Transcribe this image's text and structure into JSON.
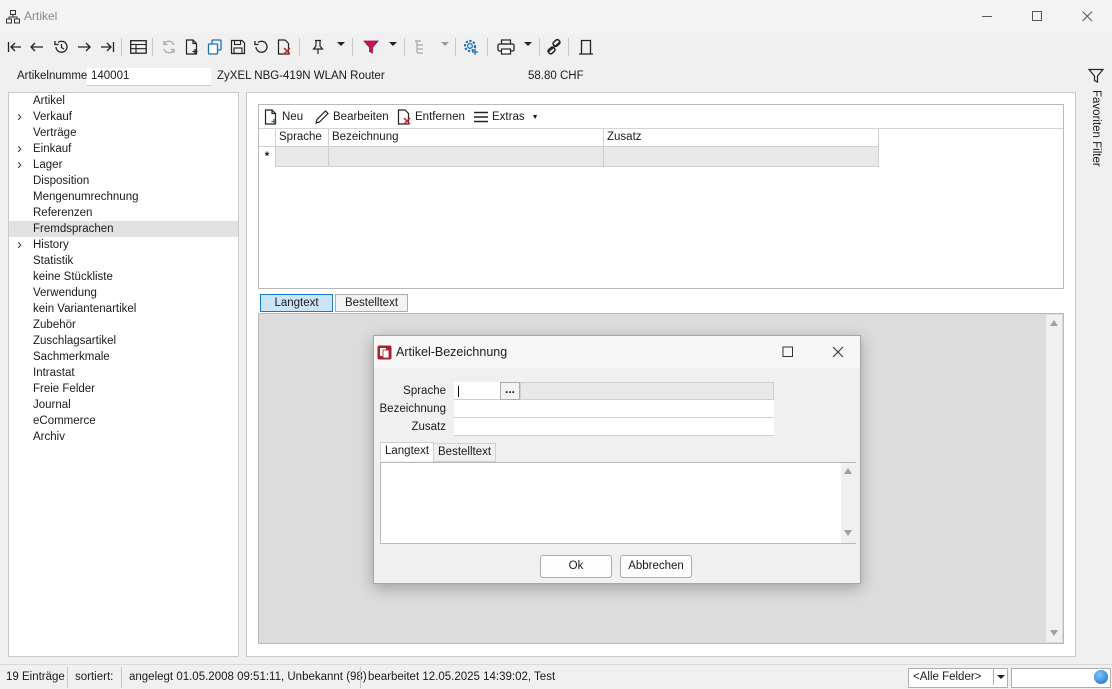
{
  "window": {
    "title": "Artikel",
    "accent_color": "#0078d4"
  },
  "toolbar": {
    "icons": [
      "first-record-icon",
      "previous-record-icon",
      "history-icon",
      "next-record-icon",
      "last-record-icon",
      "table-view-icon",
      "refresh-icon",
      "new-document-icon",
      "copy-icon",
      "save-icon",
      "undo-icon",
      "delete-icon",
      "pin-icon",
      "filter-icon",
      "tree-sort-icon",
      "settings-icon",
      "print-icon",
      "link-icon",
      "door-exit-icon"
    ]
  },
  "header": {
    "artnr_label": "Artikelnummer",
    "artnr_value": "140001",
    "name": "ZyXEL NBG-419N WLAN Router",
    "price": "58.80  CHF"
  },
  "side_filter": {
    "label": "Favoriten Filter"
  },
  "tree": {
    "items": [
      {
        "label": "Artikel",
        "expandable": false,
        "selected": false
      },
      {
        "label": "Verkauf",
        "expandable": true,
        "selected": false
      },
      {
        "label": "Verträge",
        "expandable": false,
        "selected": false
      },
      {
        "label": "Einkauf",
        "expandable": true,
        "selected": false
      },
      {
        "label": "Lager",
        "expandable": true,
        "selected": false
      },
      {
        "label": "Disposition",
        "expandable": false,
        "selected": false
      },
      {
        "label": "Mengenumrechnung",
        "expandable": false,
        "selected": false
      },
      {
        "label": "Referenzen",
        "expandable": false,
        "selected": false
      },
      {
        "label": "Fremdsprachen",
        "expandable": false,
        "selected": true
      },
      {
        "label": "History",
        "expandable": true,
        "selected": false
      },
      {
        "label": "Statistik",
        "expandable": false,
        "selected": false
      },
      {
        "label": "keine Stückliste",
        "expandable": false,
        "selected": false
      },
      {
        "label": "Verwendung",
        "expandable": false,
        "selected": false
      },
      {
        "label": "kein Variantenartikel",
        "expandable": false,
        "selected": false
      },
      {
        "label": "Zubehör",
        "expandable": false,
        "selected": false
      },
      {
        "label": "Zuschlagsartikel",
        "expandable": false,
        "selected": false
      },
      {
        "label": "Sachmerkmale",
        "expandable": false,
        "selected": false
      },
      {
        "label": "Intrastat",
        "expandable": false,
        "selected": false
      },
      {
        "label": "Freie Felder",
        "expandable": false,
        "selected": false
      },
      {
        "label": "Journal",
        "expandable": false,
        "selected": false
      },
      {
        "label": "eCommerce",
        "expandable": false,
        "selected": false
      },
      {
        "label": "Archiv",
        "expandable": false,
        "selected": false
      }
    ]
  },
  "grid": {
    "toolbar": {
      "new": "Neu",
      "edit": "Bearbeiten",
      "remove": "Entfernen",
      "extras": "Extras"
    },
    "columns": [
      "Sprache",
      "Bezeichnung",
      "Zusatz"
    ],
    "new_row_marker": "*"
  },
  "tabs": [
    "Langtext",
    "Bestelltext"
  ],
  "dialog": {
    "title": "Artikel-Bezeichnung",
    "labels": {
      "language": "Sprache",
      "description": "Bezeichnung",
      "supplement": "Zusatz"
    },
    "values": {
      "language": "",
      "description": "",
      "supplement": ""
    },
    "lookup_button": "...",
    "tabs": [
      "Langtext",
      "Bestelltext"
    ],
    "ok": "Ok",
    "cancel": "Abbrechen"
  },
  "status": {
    "count": "19 Einträge",
    "sorted": "sortiert:",
    "created": "angelegt 01.05.2008 09:51:11, Unbekannt (98)",
    "edited": "bearbeitet 12.05.2025 14:39:02, Test",
    "field_select": "<Alle Felder>"
  }
}
